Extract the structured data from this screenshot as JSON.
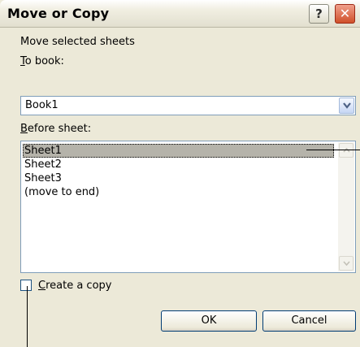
{
  "dialog": {
    "title": "Move or Copy",
    "help_glyph": "?",
    "close_glyph": "✕"
  },
  "description": "Move selected sheets",
  "to_book": {
    "label": "To book:",
    "selected_value": "Book1"
  },
  "before_sheet": {
    "label": "Before sheet:",
    "items": [
      "Sheet1",
      "Sheet2",
      "Sheet3",
      "(move to end)"
    ],
    "selected_index": 0
  },
  "copy_option": {
    "label": "Create a copy",
    "checked": false
  },
  "buttons": {
    "ok": "OK",
    "cancel": "Cancel"
  },
  "colors": {
    "dialog_bg": "#ece9d8",
    "selection": "#b5b3aa",
    "field_border": "#7f9db9",
    "close_red": "#d0502a"
  },
  "icons": [
    "help-icon",
    "close-icon",
    "chevron-down-icon",
    "scroll-up-arrow-icon",
    "scroll-down-arrow-icon"
  ]
}
